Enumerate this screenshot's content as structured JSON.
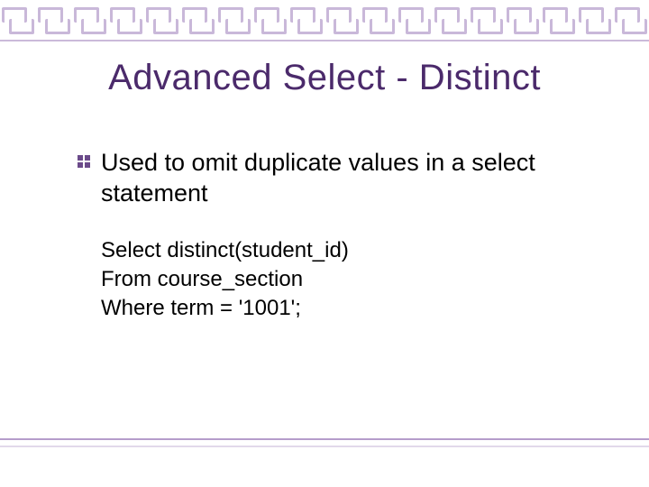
{
  "title": "Advanced Select - Distinct",
  "bullet": "Used to omit duplicate values in a select statement",
  "code": {
    "line1": "Select distinct(student_id)",
    "line2": "From course_section",
    "line3": "Where term = '1001';"
  }
}
